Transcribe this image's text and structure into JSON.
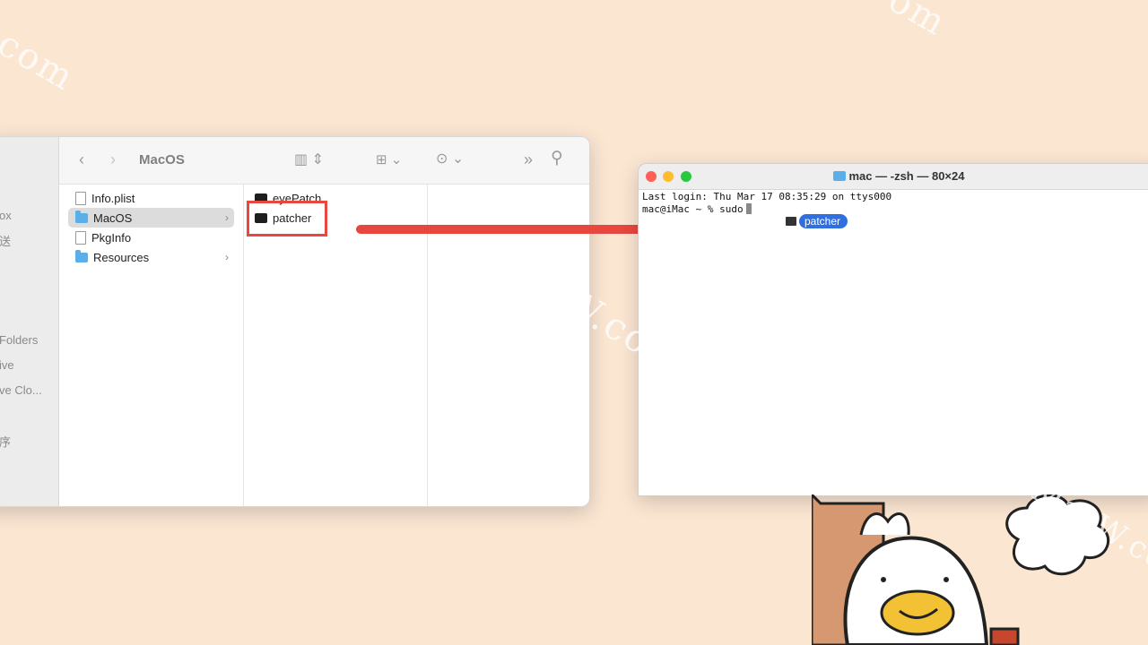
{
  "watermark": {
    "text": "MacW.com",
    "fragments": [
      "com",
      "om"
    ]
  },
  "finder": {
    "path_title": "MacOS",
    "sidebar_fragments": [
      "ox",
      "送",
      "Folders",
      "ive",
      "ve Clo...",
      "序"
    ],
    "files_column": [
      {
        "name": "Info.plist",
        "icon": "document-icon",
        "selected": false,
        "has_children": false
      },
      {
        "name": "MacOS",
        "icon": "folder-icon",
        "selected": true,
        "has_children": true
      },
      {
        "name": "PkgInfo",
        "icon": "document-icon",
        "selected": false,
        "has_children": false
      },
      {
        "name": "Resources",
        "icon": "folder-icon",
        "selected": false,
        "has_children": true
      }
    ],
    "macos_column": [
      {
        "name": "eyePatch",
        "icon": "executable-icon"
      },
      {
        "name": "patcher",
        "icon": "executable-icon"
      }
    ]
  },
  "terminal": {
    "title": "mac — -zsh — 80×24",
    "line1": "Last login: Thu Mar 17 08:35:29 on ttys000",
    "prompt": "mac@iMac ~ % sudo",
    "drag_item": "patcher"
  },
  "colors": {
    "background": "#fbe6d2",
    "highlight": "#e8473f",
    "drag_pill": "#2f6fe0",
    "folder": "#5aaee9"
  }
}
